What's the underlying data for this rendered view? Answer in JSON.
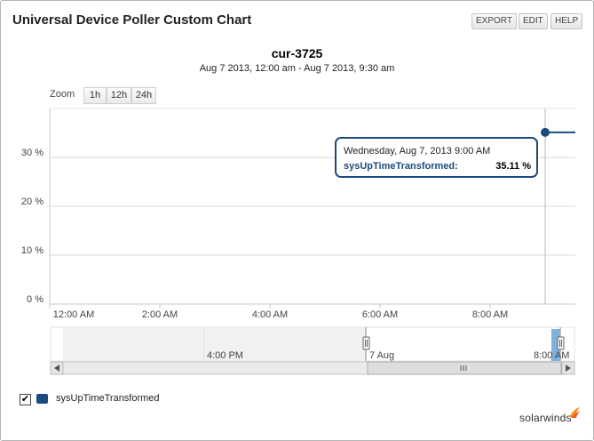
{
  "panel": {
    "title": "Universal Device Poller Custom Chart",
    "buttons": [
      "EXPORT",
      "EDIT",
      "HELP"
    ]
  },
  "chart": {
    "title": "cur-3725",
    "subtitle": "Aug 7 2013, 12:00 am - Aug 7 2013, 9:30 am"
  },
  "zoom": {
    "label": "Zoom",
    "options": [
      "1h",
      "12h",
      "24h"
    ]
  },
  "tooltip": {
    "date": "Wednesday, Aug 7, 2013 9:00 AM",
    "series": "sysUpTimeTransformed:",
    "value": "35.11 %"
  },
  "navigator": {
    "labels": [
      "4:00 PM",
      "7 Aug",
      "8:00 AM"
    ]
  },
  "legend": {
    "checked": true,
    "check_glyph": "✔",
    "label": "sysUpTimeTransformed"
  },
  "brand": "solarwinds",
  "colors": {
    "series": "#1c4a7e",
    "tooltip_border": "#1c4a7e",
    "grid": "#d9d9d9",
    "brand_accent": "#f7941d"
  },
  "chart_data": {
    "type": "line",
    "y_tick_labels": [
      "0 %",
      "10 %",
      "20 %",
      "30 %"
    ],
    "x_tick_labels": [
      "12:00 AM",
      "2:00 AM",
      "4:00 AM",
      "6:00 AM",
      "8:00 AM"
    ],
    "x_range_hours": [
      0,
      9.5
    ],
    "ylim": [
      0,
      38.5
    ],
    "series": [
      {
        "name": "sysUpTimeTransformed",
        "x_hours": [
          9.0,
          9.5
        ],
        "values": [
          35.11,
          35.11
        ]
      }
    ],
    "grid": true
  }
}
